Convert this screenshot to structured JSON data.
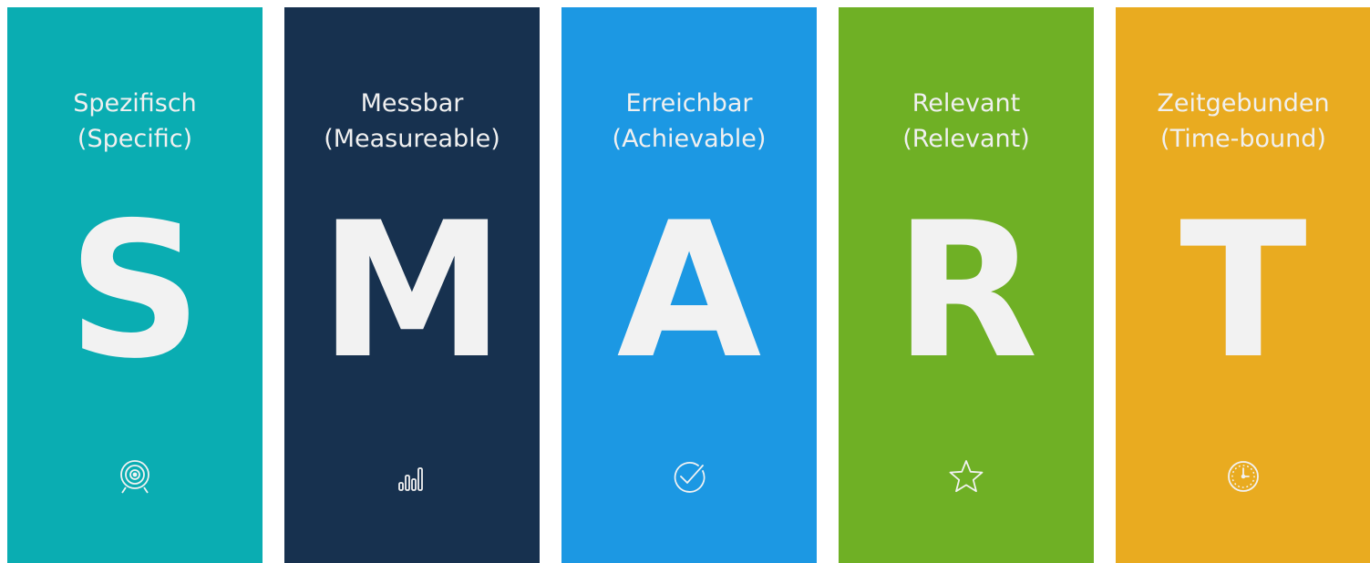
{
  "panels": [
    {
      "id": "s",
      "title_line1": "Spezifisch",
      "title_line2": "(Specific)",
      "letter": "S",
      "icon": "target-icon",
      "color": "#0aadb2"
    },
    {
      "id": "m",
      "title_line1": "Messbar",
      "title_line2": "(Measureable)",
      "letter": "M",
      "icon": "bar-chart-icon",
      "color": "#17314f"
    },
    {
      "id": "a",
      "title_line1": "Erreichbar",
      "title_line2": "(Achievable)",
      "letter": "A",
      "icon": "checkmark-circle-icon",
      "color": "#1c98e3"
    },
    {
      "id": "r",
      "title_line1": "Relevant",
      "title_line2": "(Relevant)",
      "letter": "R",
      "icon": "star-icon",
      "color": "#6fb025"
    },
    {
      "id": "t",
      "title_line1": "Zeitgebunden",
      "title_line2": "(Time-bound)",
      "letter": "T",
      "icon": "clock-icon",
      "color": "#e9ab20"
    }
  ]
}
